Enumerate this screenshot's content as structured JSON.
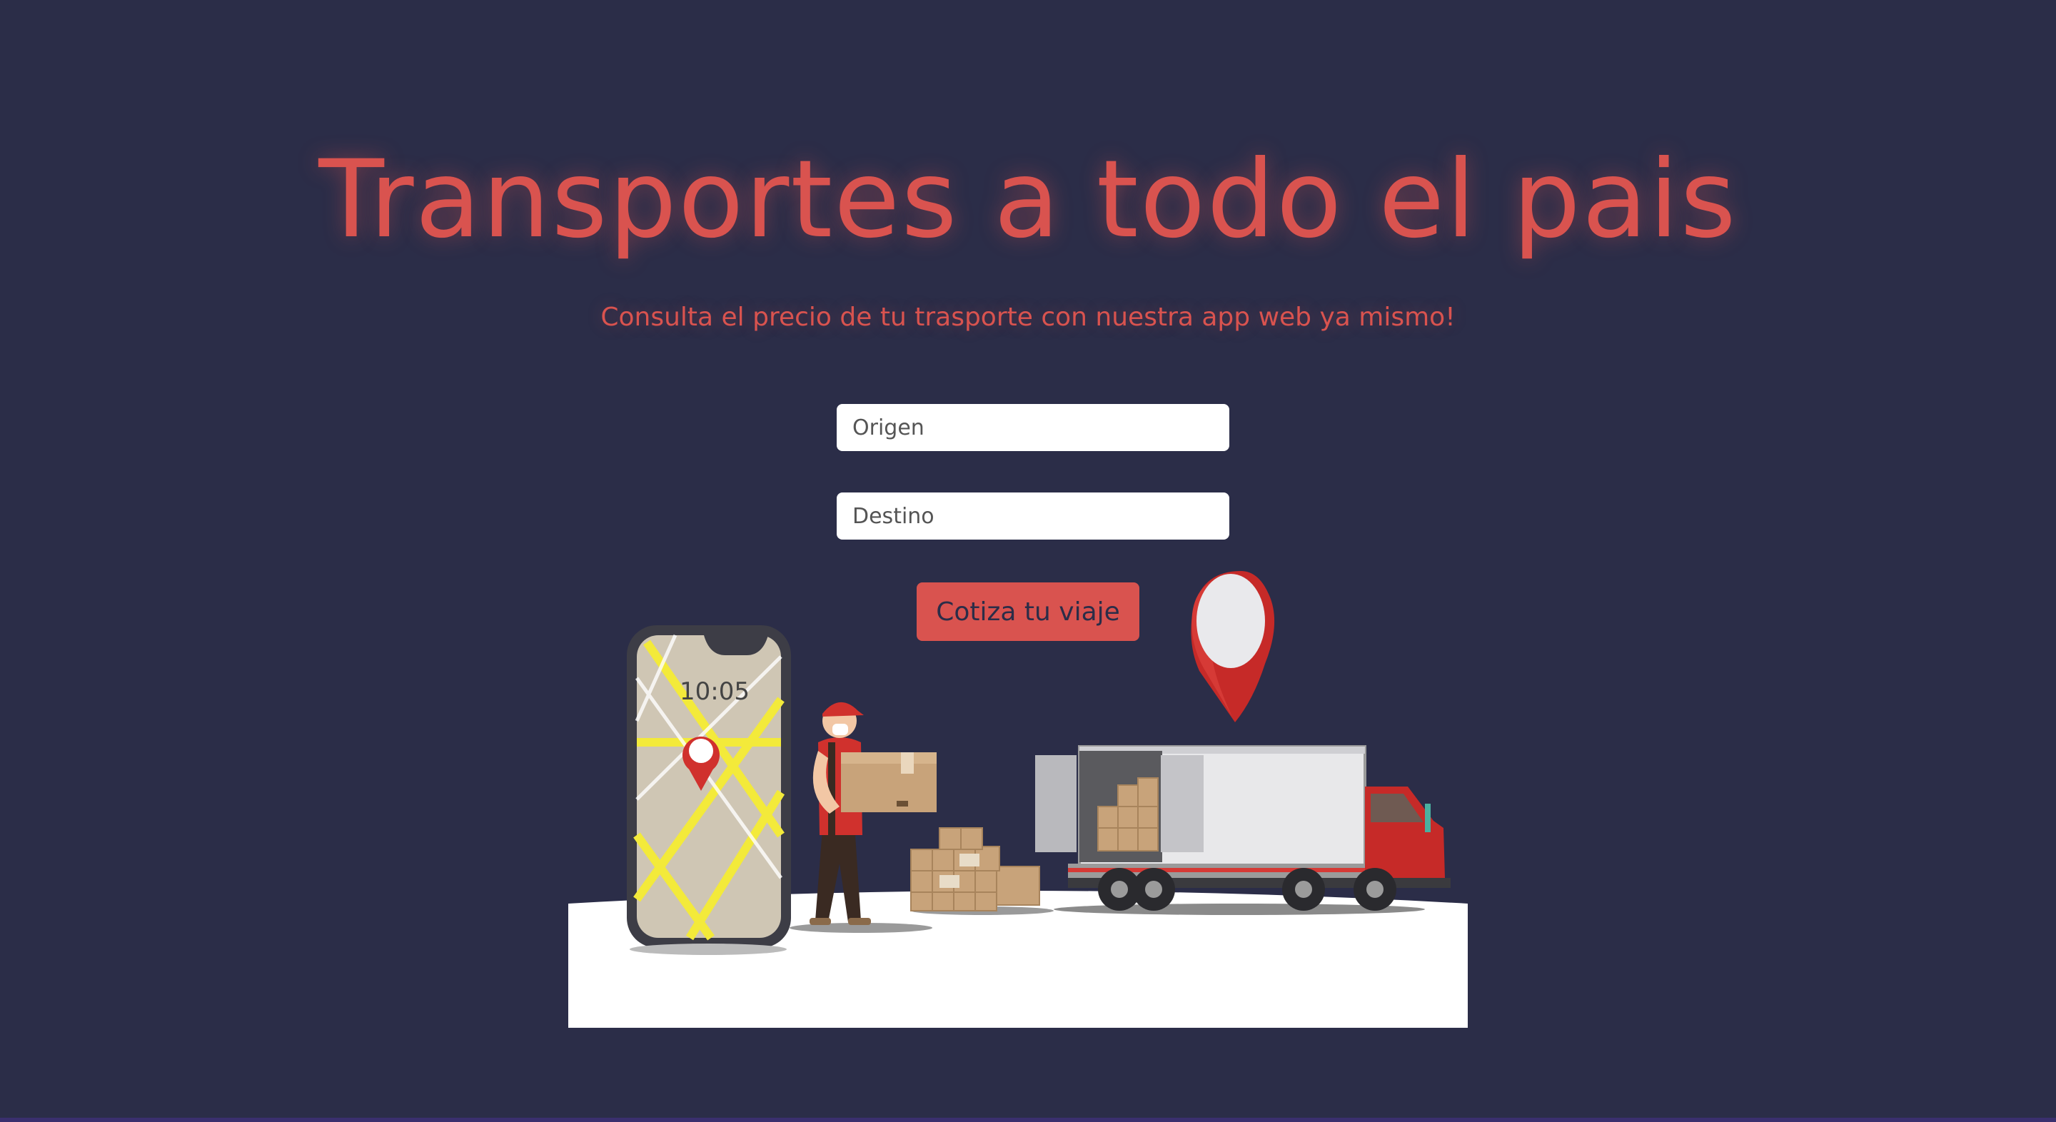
{
  "hero": {
    "title": "Transportes a todo el pais",
    "subtitle": "Consulta el precio de tu trasporte con nuestra app web ya mismo!"
  },
  "form": {
    "origin_placeholder": "Origen",
    "destination_placeholder": "Destino",
    "submit_label": "Cotiza tu viaje"
  },
  "illustration": {
    "phone_time": "10:05",
    "icons": [
      "phone-map-icon",
      "delivery-man-icon",
      "boxes-icon",
      "truck-icon",
      "location-pin-icon"
    ]
  },
  "colors": {
    "background": "#2b2d48",
    "accent": "#d9534f",
    "input_background": "#ffffff"
  }
}
